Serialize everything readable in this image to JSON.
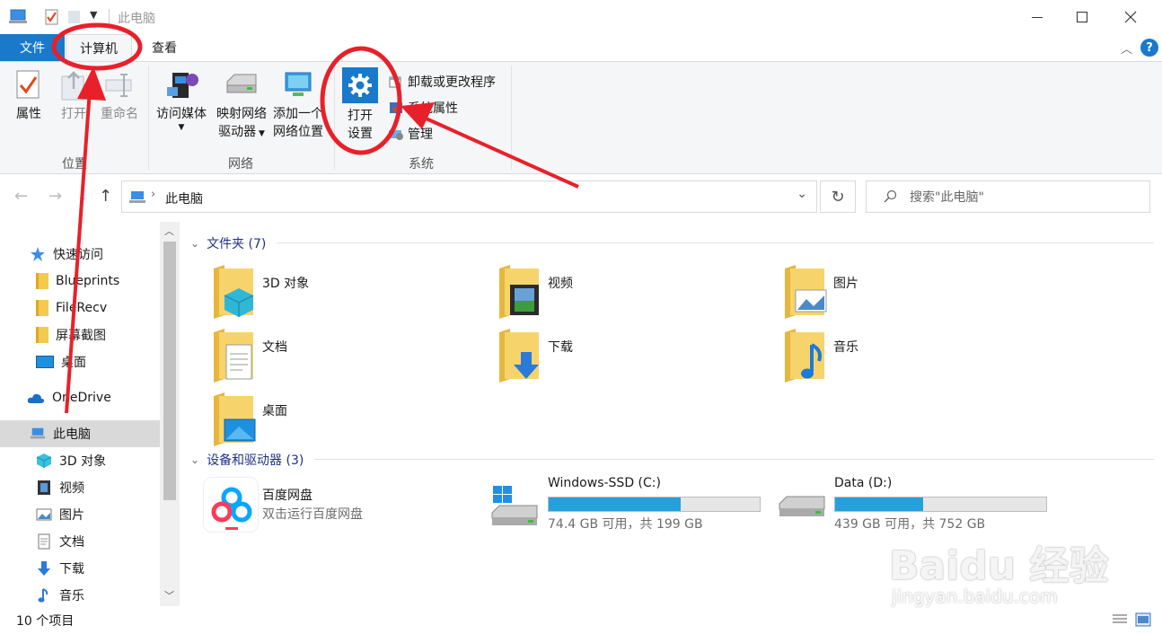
{
  "window": {
    "title": "此电脑"
  },
  "tabs": {
    "file": "文件",
    "computer": "计算机",
    "view": "查看"
  },
  "ribbon": {
    "location": {
      "properties": "属性",
      "open": "打开",
      "rename": "重命名",
      "label": "位置"
    },
    "network": {
      "media": "访问媒体",
      "map_drive_line1": "映射网络",
      "map_drive_line2": "驱动器",
      "add_location_line1": "添加一个",
      "add_location_line2": "网络位置",
      "label": "网络"
    },
    "system": {
      "open_settings_line1": "打开",
      "open_settings_line2": "设置",
      "uninstall": "卸载或更改程序",
      "system_properties": "系统属性",
      "manage": "管理",
      "label": "系统"
    }
  },
  "address": {
    "path": "此电脑",
    "search_placeholder": "搜索\"此电脑\""
  },
  "nav": {
    "quick_access": "快速访问",
    "items": [
      "Blueprints",
      "FileRecv",
      "屏幕截图",
      "桌面"
    ],
    "onedrive": "OneDrive",
    "this_pc": "此电脑",
    "pc_items": [
      "3D 对象",
      "视频",
      "图片",
      "文档",
      "下载",
      "音乐"
    ]
  },
  "content": {
    "folders_header": "文件夹 (7)",
    "folders": [
      "3D 对象",
      "视频",
      "图片",
      "文档",
      "下载",
      "音乐",
      "桌面"
    ],
    "devices_header": "设备和驱动器 (3)",
    "baidu_name": "百度网盘",
    "baidu_sub": "双击运行百度网盘",
    "drives": [
      {
        "name": "Windows-SSD (C:)",
        "info": "74.4 GB 可用，共 199 GB",
        "used_fraction": 0.626
      },
      {
        "name": "Data (D:)",
        "info": "439 GB 可用，共 752 GB",
        "used_fraction": 0.416
      }
    ]
  },
  "status": {
    "count": "10 个项目"
  },
  "watermark": {
    "main": "Baidu 经验",
    "sub": "jingyan.baidu.com"
  },
  "colors": {
    "accent": "#1979ca",
    "annotation": "#e8202a",
    "drive_bar": "#26a0da"
  }
}
